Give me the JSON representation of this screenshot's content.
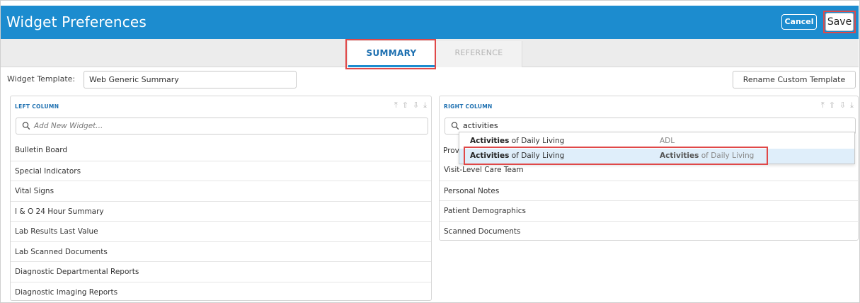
{
  "window": {
    "title": "Widget Preferences",
    "cancel_label": "Cancel",
    "save_label": "Save"
  },
  "tabs": [
    {
      "label": "SUMMARY",
      "active": true
    },
    {
      "label": "REFERENCE",
      "active": false
    }
  ],
  "template": {
    "label": "Widget Template:",
    "value": "Web Generic Summary",
    "rename_label": "Rename Custom Template"
  },
  "left_column": {
    "title": "LEFT COLUMN",
    "search_placeholder": "Add New Widget...",
    "items": [
      "Bulletin Board",
      "Special Indicators",
      "Vital Signs",
      "I & O 24 Hour Summary",
      "Lab Results Last Value",
      "Lab Scanned Documents",
      "Diagnostic Departmental Reports",
      "Diagnostic Imaging Reports"
    ]
  },
  "right_column": {
    "title": "RIGHT COLUMN",
    "search_value": "activities",
    "partial_item": "Prov",
    "items": [
      "Visit-Level Care Team",
      "Personal Notes",
      "Patient Demographics",
      "Scanned Documents"
    ]
  },
  "dropdown": {
    "results": [
      {
        "match": "Activities",
        "rest": " of Daily Living",
        "alias_match": "",
        "alias_rest": "ADL"
      },
      {
        "match": "Activities",
        "rest": " of Daily Living",
        "alias_match": "Activities",
        "alias_rest": " of Daily Living"
      }
    ]
  },
  "icons": {
    "reorder": [
      "move-top-icon",
      "move-up-icon",
      "move-down-icon",
      "move-bottom-icon"
    ],
    "search": "search-icon"
  },
  "colors": {
    "title_bar": "#1c8ccf",
    "accent": "#1c6fb0",
    "highlight_box": "#e04848",
    "selected_row": "#dfeefa"
  }
}
